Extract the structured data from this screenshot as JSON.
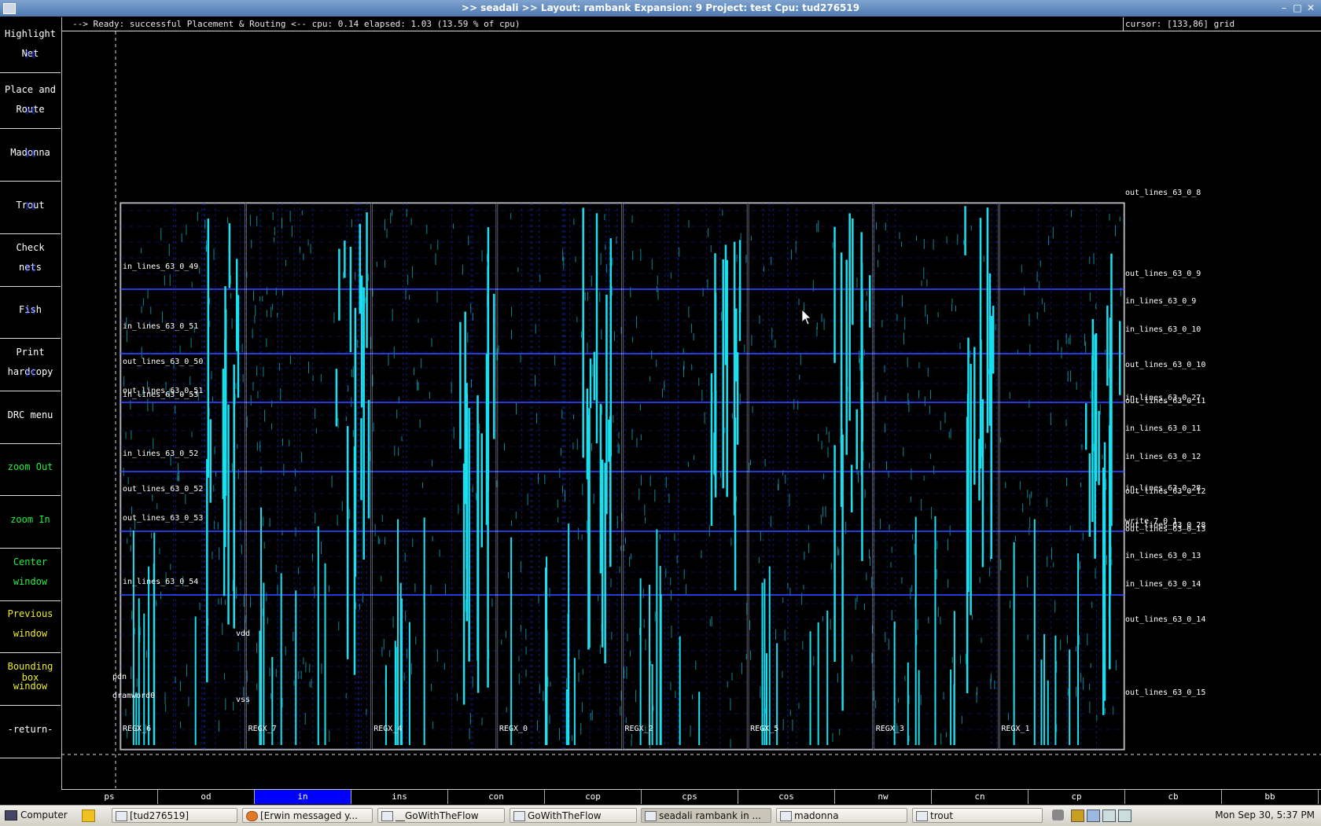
{
  "window": {
    "title": ">> seadali >>   Layout: rambank  Expansion: 9  Project: test  Cpu: tud276519",
    "controls": [
      "–",
      "□",
      "✕"
    ]
  },
  "status": {
    "message": "--> Ready: successful Placement & Routing <-- cpu: 0.14  elapsed: 1.03 (13.59 % of cpu)",
    "cursor": "cursor: [133,86] grid"
  },
  "sidebar": {
    "buttons": [
      {
        "line1": "Highlight",
        "line2": "Net",
        "arrows": true
      },
      {
        "line1": "Place and",
        "line2": "Route",
        "arrows": true
      },
      {
        "line1": "Madonna",
        "line2": "",
        "arrows": true
      },
      {
        "line1": "Trout",
        "line2": "",
        "arrows": true
      },
      {
        "line1": "Check",
        "line2": "nets",
        "arrows": true
      },
      {
        "line1": "Fish",
        "line2": "",
        "arrows": true
      },
      {
        "line1": "Print",
        "line2": "hardcopy",
        "arrows": true
      },
      {
        "line1": "DRC menu",
        "line2": "",
        "arrows": false
      },
      {
        "line1": "zoom Out",
        "line2": "",
        "arrows": false
      },
      {
        "line1": "zoom In",
        "line2": "",
        "arrows": false
      },
      {
        "line1": "Center",
        "line2": "window",
        "arrows": false
      },
      {
        "line1": "Previous",
        "line2": "window",
        "arrows": false
      },
      {
        "line1": "Bounding box",
        "line2": "window",
        "arrows": false
      },
      {
        "line1": "-return-",
        "line2": "",
        "arrows": false
      }
    ]
  },
  "layout": {
    "cells": [
      "REGX_6",
      "REGX_7",
      "REGX_4",
      "REGX_0",
      "REGX_2",
      "REGX_5",
      "REGX_3",
      "REGX_1"
    ],
    "left_labels": [
      "in_lines_63_0_49",
      "in_lines_63_0_51",
      "out_lines_63_0_50",
      "out_lines_63_0_51",
      "in_lines_63_0_53",
      "in_lines_63_0_52",
      "out_lines_63_0_52",
      "out_lines_63_0_53",
      "in_lines_63_0_54"
    ],
    "right_labels": [
      "out_lines_63_0_8",
      "out_lines_63_0_9",
      "in_lines_63_0_9",
      "in_lines_63_0_10",
      "out_lines_63_0_10",
      "in_lines_63_0_27",
      "out_lines_63_0_11",
      "in_lines_63_0_11",
      "in_lines_63_0_12",
      "in_lines_63_0_28",
      "out_lines_63_0_12",
      "write_7_0_1",
      "out_lines_63_0_28",
      "out_lines_63_0_13",
      "in_lines_63_0_13",
      "in_lines_63_0_14",
      "out_lines_63_0_14",
      "out_lines_63_0_15"
    ],
    "misc_labels": [
      "vdd",
      "vss",
      "dramword0",
      "pdn"
    ]
  },
  "tabs": [
    {
      "label": "ps",
      "active": false
    },
    {
      "label": "od",
      "active": false
    },
    {
      "label": "in",
      "active": true
    },
    {
      "label": "ins",
      "active": false
    },
    {
      "label": "con",
      "active": false
    },
    {
      "label": "cop",
      "active": false
    },
    {
      "label": "cps",
      "active": false
    },
    {
      "label": "cos",
      "active": false
    },
    {
      "label": "nw",
      "active": false
    },
    {
      "label": "cn",
      "active": false
    },
    {
      "label": "cp",
      "active": false
    },
    {
      "label": "cb",
      "active": false
    },
    {
      "label": "bb",
      "active": false
    }
  ],
  "taskbar": {
    "menu": "Computer",
    "tasks": [
      "[tud276519]",
      "[Erwin messaged y...",
      "__GoWithTheFlow",
      "GoWithTheFlow",
      "seadali  rambank in ...",
      "madonna",
      "trout"
    ],
    "active_task": 4,
    "clock": "Mon Sep 30,  5:37 PM"
  },
  "colors": {
    "canvas_bg": "#000000",
    "metal_cyan": "#19e0f0",
    "poly_blue": "#1a2fcf",
    "active_tab": "#0000ff",
    "button_green": "#22ee44",
    "button_yellow": "#eeee22"
  }
}
